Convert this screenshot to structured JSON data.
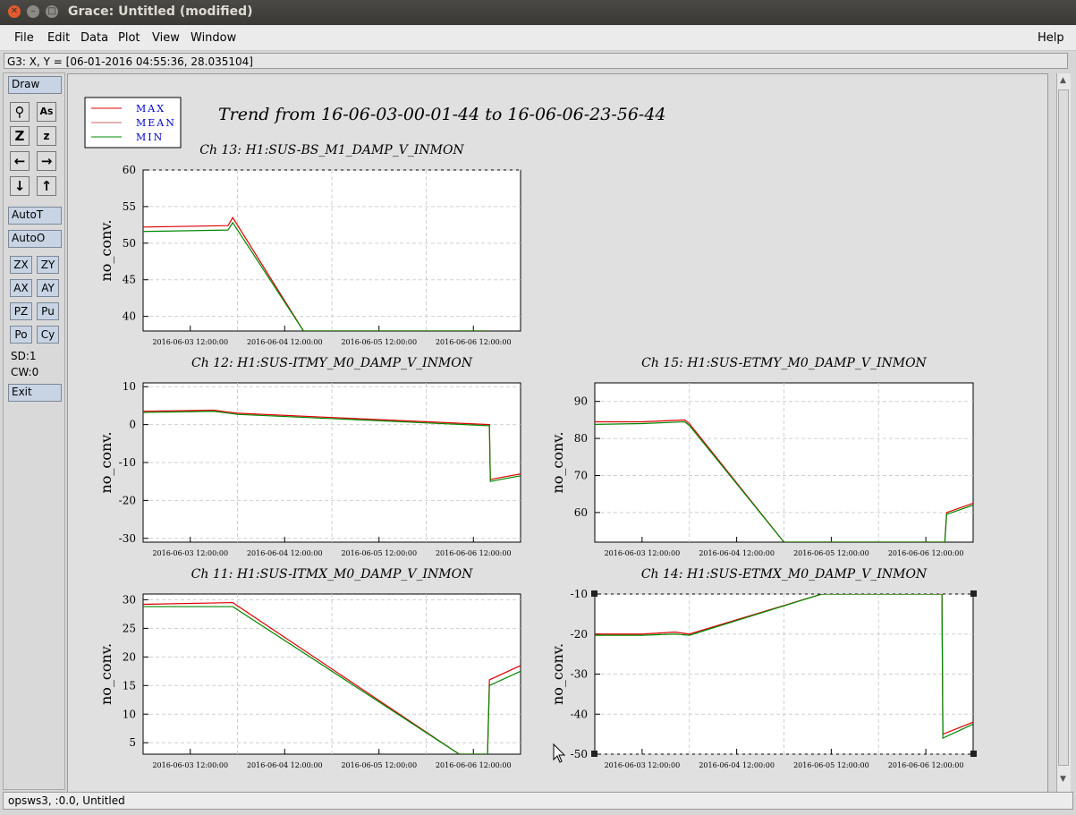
{
  "window": {
    "title": "Grace: Untitled (modified)"
  },
  "menubar": {
    "items": [
      "File",
      "Edit",
      "Data",
      "Plot",
      "View",
      "Window"
    ],
    "help": "Help"
  },
  "locator": {
    "text": "G3: X, Y = [06-01-2016 04:55:36, 28.035104]"
  },
  "toolbar": {
    "draw": "Draw",
    "autoT": "AutoT",
    "autoO": "AutoO",
    "small_buttons": [
      [
        "ZX",
        "ZY"
      ],
      [
        "AX",
        "AY"
      ],
      [
        "PZ",
        "Pu"
      ],
      [
        "Po",
        "Cy"
      ]
    ],
    "sd": "SD:1",
    "cw": "CW:0",
    "exit": "Exit"
  },
  "status": {
    "text": "opsws3, :0.0, Untitled"
  },
  "legend": {
    "entries": [
      {
        "label": "MAX",
        "color": "#dd0000"
      },
      {
        "label": "MEAN",
        "color": "#c86464"
      },
      {
        "label": "MIN",
        "color": "#008800"
      }
    ]
  },
  "main_title": "Trend from 16-06-03-00-01-44 to 16-06-06-23-56-44",
  "chart_data": [
    {
      "type": "line",
      "title": "Ch 13: H1:SUS-BS_M1_DAMP_V_INMON",
      "ylabel": "no_conv.",
      "xticks": [
        "2016-06-03 12:00:00",
        "2016-06-04 12:00:00",
        "2016-06-05 12:00:00",
        "2016-06-06 12:00:00"
      ],
      "yticks": [
        40,
        45,
        50,
        55,
        60
      ],
      "ylim": [
        38,
        60
      ],
      "xlim": [
        0,
        4
      ],
      "series": [
        {
          "name": "MAX",
          "x": [
            0,
            0.9,
            0.95,
            1.7,
            3.65
          ],
          "y": [
            52.2,
            52.4,
            53.5,
            38,
            38
          ]
        },
        {
          "name": "MIN",
          "x": [
            0,
            0.9,
            0.95,
            1.7,
            3.65
          ],
          "y": [
            51.6,
            51.8,
            52.8,
            38,
            38
          ]
        }
      ]
    },
    {
      "type": "line",
      "title": "Ch 12: H1:SUS-ITMY_M0_DAMP_V_INMON",
      "ylabel": "no_conv.",
      "xticks": [
        "2016-06-03 12:00:00",
        "2016-06-04 12:00:00",
        "2016-06-05 12:00:00",
        "2016-06-06 12:00:00"
      ],
      "yticks": [
        -30,
        -20,
        -10,
        0,
        10
      ],
      "ylim": [
        -31,
        11
      ],
      "xlim": [
        0,
        4
      ],
      "series": [
        {
          "name": "MAX",
          "x": [
            0,
            0.75,
            1.0,
            3.67,
            3.68,
            3.78,
            4.0
          ],
          "y": [
            3.5,
            3.8,
            3.0,
            0.0,
            -14.5,
            -14.0,
            -13.0
          ]
        },
        {
          "name": "MIN",
          "x": [
            0,
            0.75,
            1.0,
            3.67,
            3.68,
            3.78,
            4.0
          ],
          "y": [
            3.2,
            3.5,
            2.7,
            -0.3,
            -15.0,
            -14.5,
            -13.5
          ]
        }
      ]
    },
    {
      "type": "line",
      "title": "Ch 15: H1:SUS-ETMY_M0_DAMP_V_INMON",
      "ylabel": "no_conv.",
      "xticks": [
        "2016-06-03 12:00:00",
        "2016-06-04 12:00:00",
        "2016-06-05 12:00:00",
        "2016-06-06 12:00:00"
      ],
      "yticks": [
        60,
        70,
        80,
        90
      ],
      "ylim": [
        52,
        95
      ],
      "xlim": [
        0,
        4
      ],
      "series": [
        {
          "name": "MAX",
          "x": [
            0,
            0.5,
            0.95,
            1.0,
            2.0,
            3.7,
            3.72,
            4.0
          ],
          "y": [
            84.5,
            84.5,
            85,
            84,
            52,
            52,
            60,
            62.5
          ]
        },
        {
          "name": "MIN",
          "x": [
            0,
            0.5,
            0.95,
            1.0,
            2.0,
            3.7,
            3.72,
            4.0
          ],
          "y": [
            83.8,
            84.0,
            84.5,
            83.5,
            52,
            52,
            59.5,
            62
          ]
        }
      ]
    },
    {
      "type": "line",
      "title": "Ch 11: H1:SUS-ITMX_M0_DAMP_V_INMON",
      "ylabel": "no_conv.",
      "xticks": [
        "2016-06-03 12:00:00",
        "2016-06-04 12:00:00",
        "2016-06-05 12:00:00",
        "2016-06-06 12:00:00"
      ],
      "yticks": [
        5,
        10,
        15,
        20,
        25,
        30
      ],
      "ylim": [
        3,
        31
      ],
      "xlim": [
        0,
        4
      ],
      "series": [
        {
          "name": "MAX",
          "x": [
            0,
            0.95,
            3.35,
            3.65,
            3.67,
            4.0
          ],
          "y": [
            29.2,
            29.5,
            3,
            3,
            16,
            18.5
          ]
        },
        {
          "name": "MIN",
          "x": [
            0,
            0.95,
            3.35,
            3.65,
            3.67,
            4.0
          ],
          "y": [
            28.8,
            28.8,
            3,
            3,
            15,
            17.5
          ]
        }
      ]
    },
    {
      "type": "line",
      "title": "Ch 14: H1:SUS-ETMX_M0_DAMP_V_INMON",
      "ylabel": "no_conv.",
      "xticks": [
        "2016-06-03 12:00:00",
        "2016-06-04 12:00:00",
        "2016-06-05 12:00:00",
        "2016-06-06 12:00:00"
      ],
      "yticks": [
        -50,
        -40,
        -30,
        -20,
        -10
      ],
      "ylim": [
        -50,
        -10
      ],
      "xlim": [
        0,
        4
      ],
      "series": [
        {
          "name": "MAX",
          "x": [
            0,
            0.5,
            0.85,
            1.0,
            2.4,
            3.67,
            3.68,
            4.0
          ],
          "y": [
            -20,
            -20,
            -19.5,
            -20,
            -10,
            -10,
            -45,
            -42
          ]
        },
        {
          "name": "MIN",
          "x": [
            0,
            0.5,
            0.85,
            1.0,
            2.4,
            3.67,
            3.68,
            4.0
          ],
          "y": [
            -20.3,
            -20.3,
            -20,
            -20.3,
            -10,
            -10,
            -46,
            -42.5
          ]
        }
      ]
    }
  ]
}
